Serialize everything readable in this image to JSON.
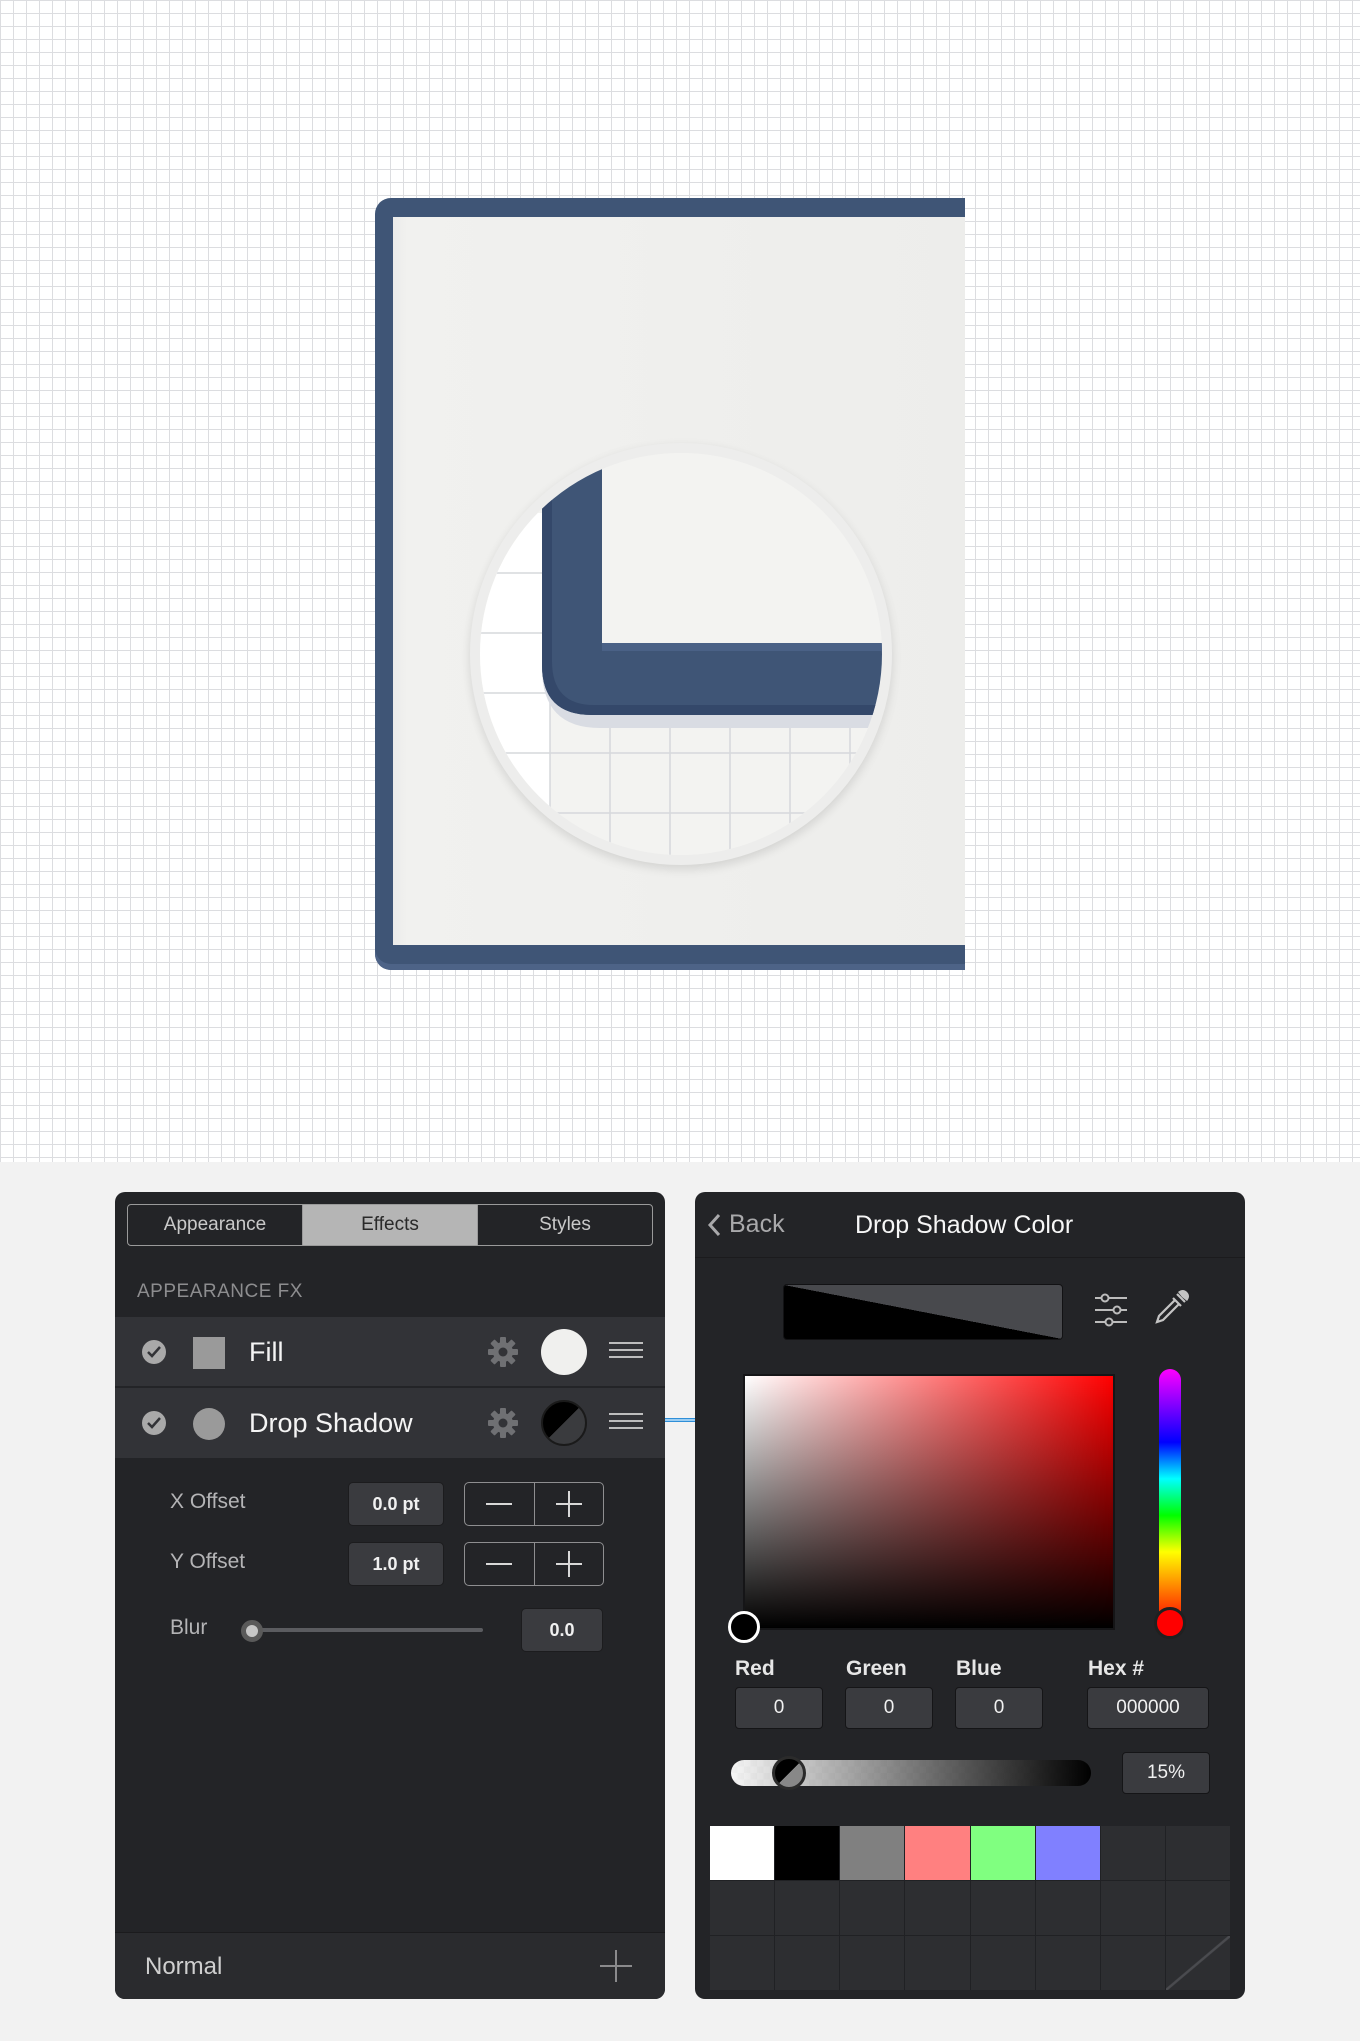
{
  "appearance_panel": {
    "tabs": [
      {
        "label": "Appearance",
        "active": false
      },
      {
        "label": "Effects",
        "active": true
      },
      {
        "label": "Styles",
        "active": false
      }
    ],
    "section_label": "APPEARANCE FX",
    "effects": [
      {
        "label": "Fill",
        "enabled": true,
        "color": "#f0f0ee"
      },
      {
        "label": "Drop Shadow",
        "enabled": true,
        "color": "#000000"
      }
    ],
    "params": {
      "x_offset_label": "X Offset",
      "x_offset_value": "0.0 pt",
      "y_offset_label": "Y Offset",
      "y_offset_value": "1.0 pt",
      "blur_label": "Blur",
      "blur_value": "0.0",
      "blur_slider_level": 0
    },
    "blend_mode": "Normal"
  },
  "color_panel": {
    "back_label": "Back",
    "title": "Drop Shadow Color",
    "channels": [
      {
        "label": "Red",
        "value": "0"
      },
      {
        "label": "Green",
        "value": "0"
      },
      {
        "label": "Blue",
        "value": "0"
      }
    ],
    "hex_label": "Hex #",
    "hex_value": "000000",
    "opacity": "15%",
    "hue_color": "#ff0000",
    "swatches": [
      "#ffffff",
      "#000000",
      "#808080",
      "#ff8080",
      "#80ff80",
      "#8080ff",
      "",
      "",
      "",
      "",
      "",
      "",
      "",
      "",
      "",
      "",
      "",
      "",
      "",
      "",
      "",
      "",
      "",
      ""
    ]
  },
  "colors": {
    "frame": "#3f5576",
    "page": "#ededeb",
    "panel_bg": "#232427"
  }
}
